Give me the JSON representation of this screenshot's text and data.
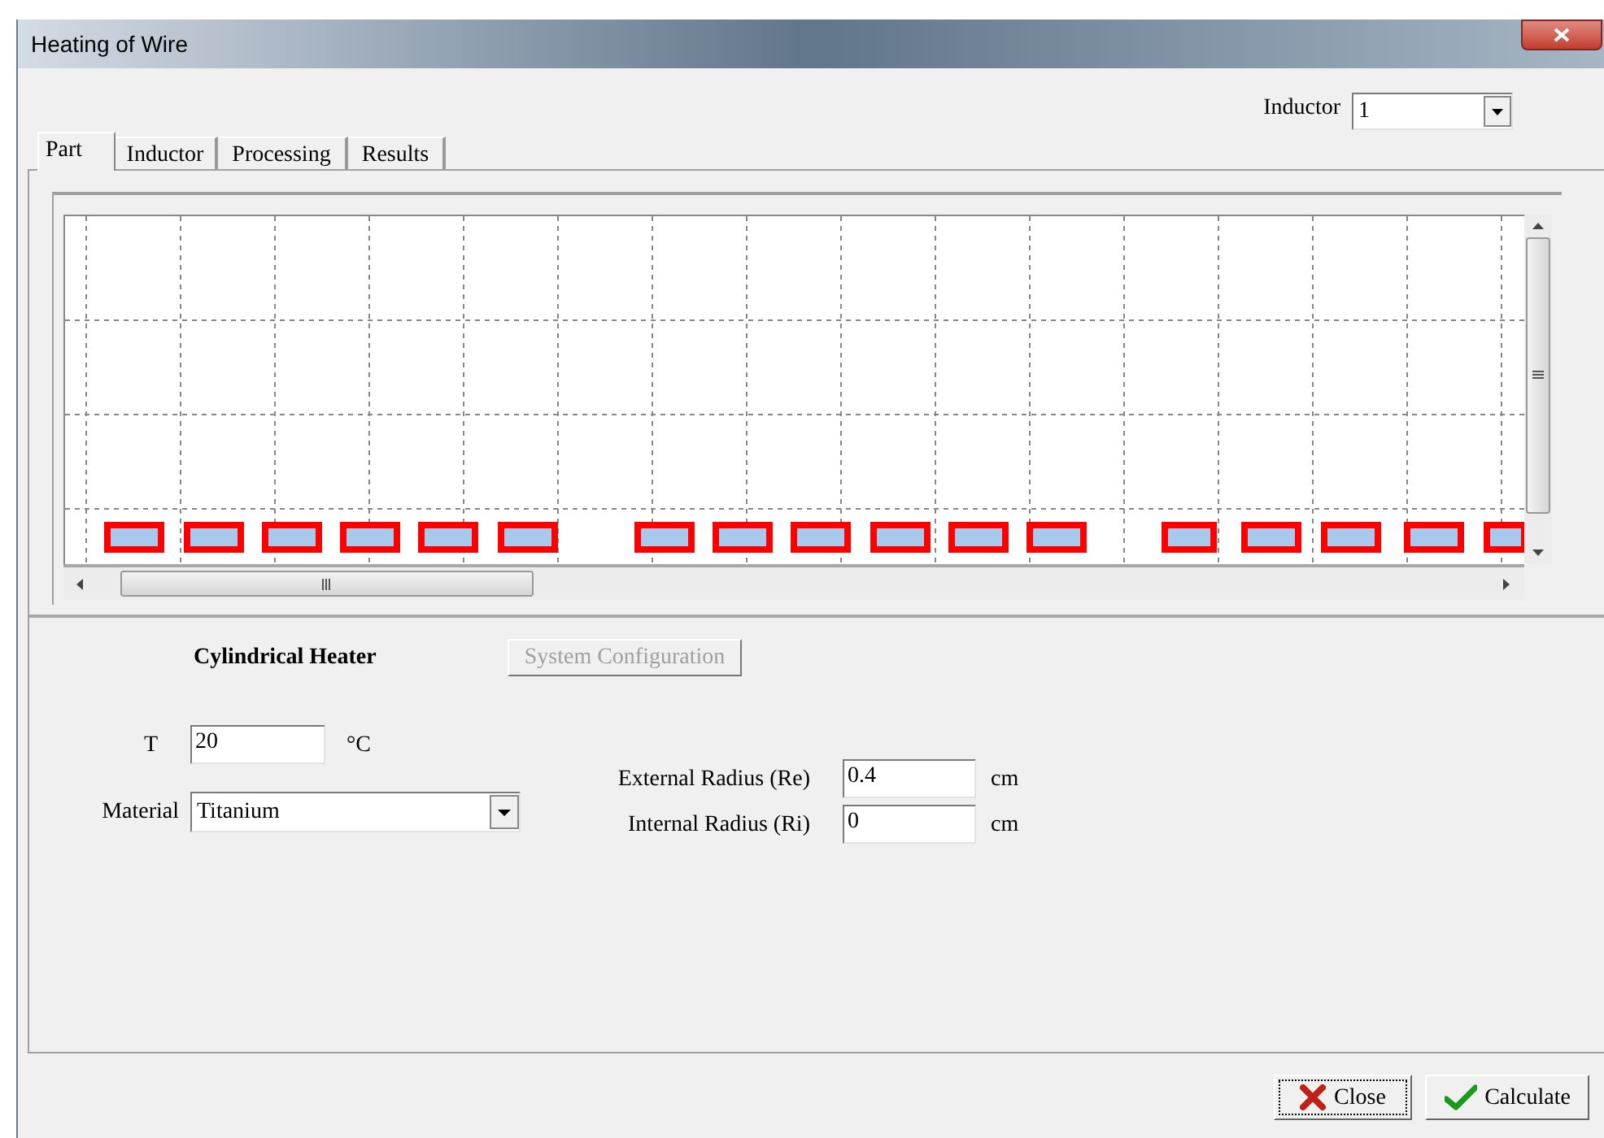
{
  "window": {
    "title": "Heating of Wire"
  },
  "inductor_selector": {
    "label": "Inductor",
    "value": "1"
  },
  "tabs": [
    {
      "label": "Part",
      "selected": true
    },
    {
      "label": "Inductor",
      "selected": false
    },
    {
      "label": "Processing",
      "selected": false
    },
    {
      "label": "Results",
      "selected": false
    }
  ],
  "part": {
    "heading": "Cylindrical Heater",
    "system_configuration": {
      "label": "System Configuration",
      "disabled": true
    },
    "temperature": {
      "label": "T",
      "value": "20",
      "unit": "°C"
    },
    "material": {
      "label": "Material",
      "value": "Titanium"
    },
    "external_radius": {
      "label": "External Radius (Re)",
      "value": "0.4",
      "unit": "cm"
    },
    "internal_radius": {
      "label": "Internal Radius (Ri)",
      "value": "0",
      "unit": "cm"
    }
  },
  "buttons": [
    {
      "label": "Close",
      "kind": "close",
      "focused": true
    },
    {
      "label": "Calculate",
      "kind": "calculate",
      "focused": false
    }
  ]
}
